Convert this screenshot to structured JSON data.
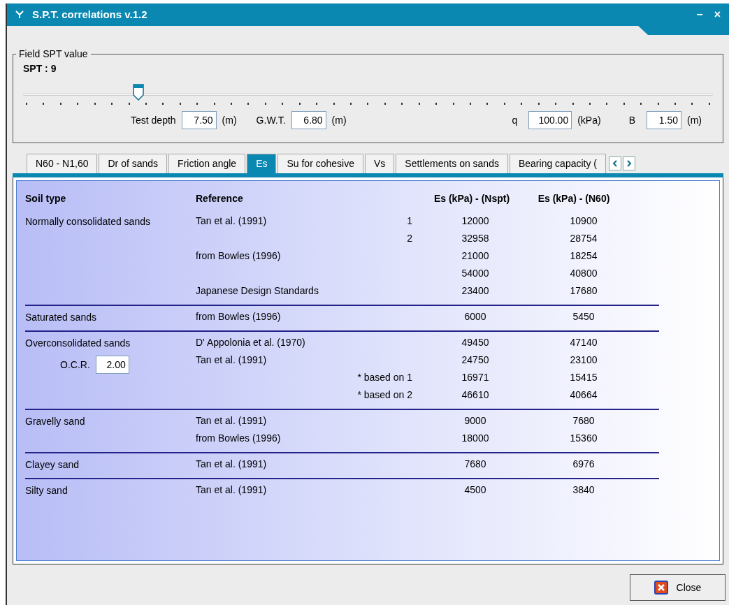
{
  "window": {
    "title": "S.P.T. correlations v.1.2",
    "buttons": [
      "−",
      "×"
    ]
  },
  "field_spt": {
    "legend": "Field SPT value",
    "spt_label": "SPT : 9",
    "slider": {
      "level": 0.167
    },
    "inputs": [
      {
        "label": "Test depth",
        "value": "7.50",
        "unit": "(m)"
      },
      {
        "label": "G.W.T.",
        "value": "6.80",
        "unit": "(m)"
      },
      {
        "label": "q",
        "value": "100.00",
        "unit": "(kPa)"
      },
      {
        "label": "B",
        "value": "1.50",
        "unit": "(m)"
      }
    ]
  },
  "tabs": [
    {
      "label": "N60 - N1,60",
      "selected": false
    },
    {
      "label": "Dr of sands",
      "selected": false
    },
    {
      "label": "Friction angle",
      "selected": false
    },
    {
      "label": "Es",
      "selected": true
    },
    {
      "label": "Su for cohesive",
      "selected": false
    },
    {
      "label": "Vs",
      "selected": false
    },
    {
      "label": "Settlements on sands",
      "selected": false
    },
    {
      "label": "Bearing capacity (",
      "selected": false
    }
  ],
  "table": {
    "columns": [
      "Soil type",
      "Reference",
      "Es (kPa) - (Nspt)",
      "Es (kPa) - (N60)"
    ],
    "groups": [
      {
        "soil": "Normally consolidated sands",
        "rows": [
          {
            "reference": "Tan et al. (1991)",
            "note": "1",
            "nspt": "12000",
            "n60": "10900"
          },
          {
            "reference": "",
            "note": "2",
            "nspt": "32958",
            "n60": "28754"
          },
          {
            "reference": "from Bowles (1996)",
            "note": "",
            "nspt": "21000",
            "n60": "18254"
          },
          {
            "reference": "",
            "note": "",
            "nspt": "54000",
            "n60": "40800"
          },
          {
            "reference": "Japanese Design Standards",
            "note": "",
            "nspt": "23400",
            "n60": "17680"
          }
        ]
      },
      {
        "soil": "Saturated sands",
        "rows": [
          {
            "reference": "from Bowles (1996)",
            "note": "",
            "nspt": "6000",
            "n60": "5450"
          }
        ]
      },
      {
        "soil": "Overconsolidated sands",
        "ocr": {
          "label": "O.C.R.",
          "value": "2.00"
        },
        "rows": [
          {
            "reference": "D' Appolonia et al. (1970)",
            "note": "",
            "nspt": "49450",
            "n60": "47140"
          },
          {
            "reference": "Tan et al. (1991)",
            "note": "",
            "nspt": "24750",
            "n60": "23100"
          },
          {
            "reference": "",
            "note": "* based on 1",
            "nspt": "16971",
            "n60": "15415"
          },
          {
            "reference": "",
            "note": "* based on 2",
            "nspt": "46610",
            "n60": "40664"
          }
        ]
      },
      {
        "soil": "Gravelly sand",
        "rows": [
          {
            "reference": "Tan et al. (1991)",
            "note": "",
            "nspt": "9000",
            "n60": "7680"
          },
          {
            "reference": "from Bowles (1996)",
            "note": "",
            "nspt": "18000",
            "n60": "15360"
          }
        ]
      },
      {
        "soil": "Clayey sand",
        "rows": [
          {
            "reference": "Tan et al. (1991)",
            "note": "",
            "nspt": "7680",
            "n60": "6976"
          }
        ]
      },
      {
        "soil": "Silty sand",
        "rows": [
          {
            "reference": "Tan et al. (1991)",
            "note": "",
            "nspt": "4500",
            "n60": "3840"
          }
        ]
      }
    ]
  },
  "close_button": "Close"
}
